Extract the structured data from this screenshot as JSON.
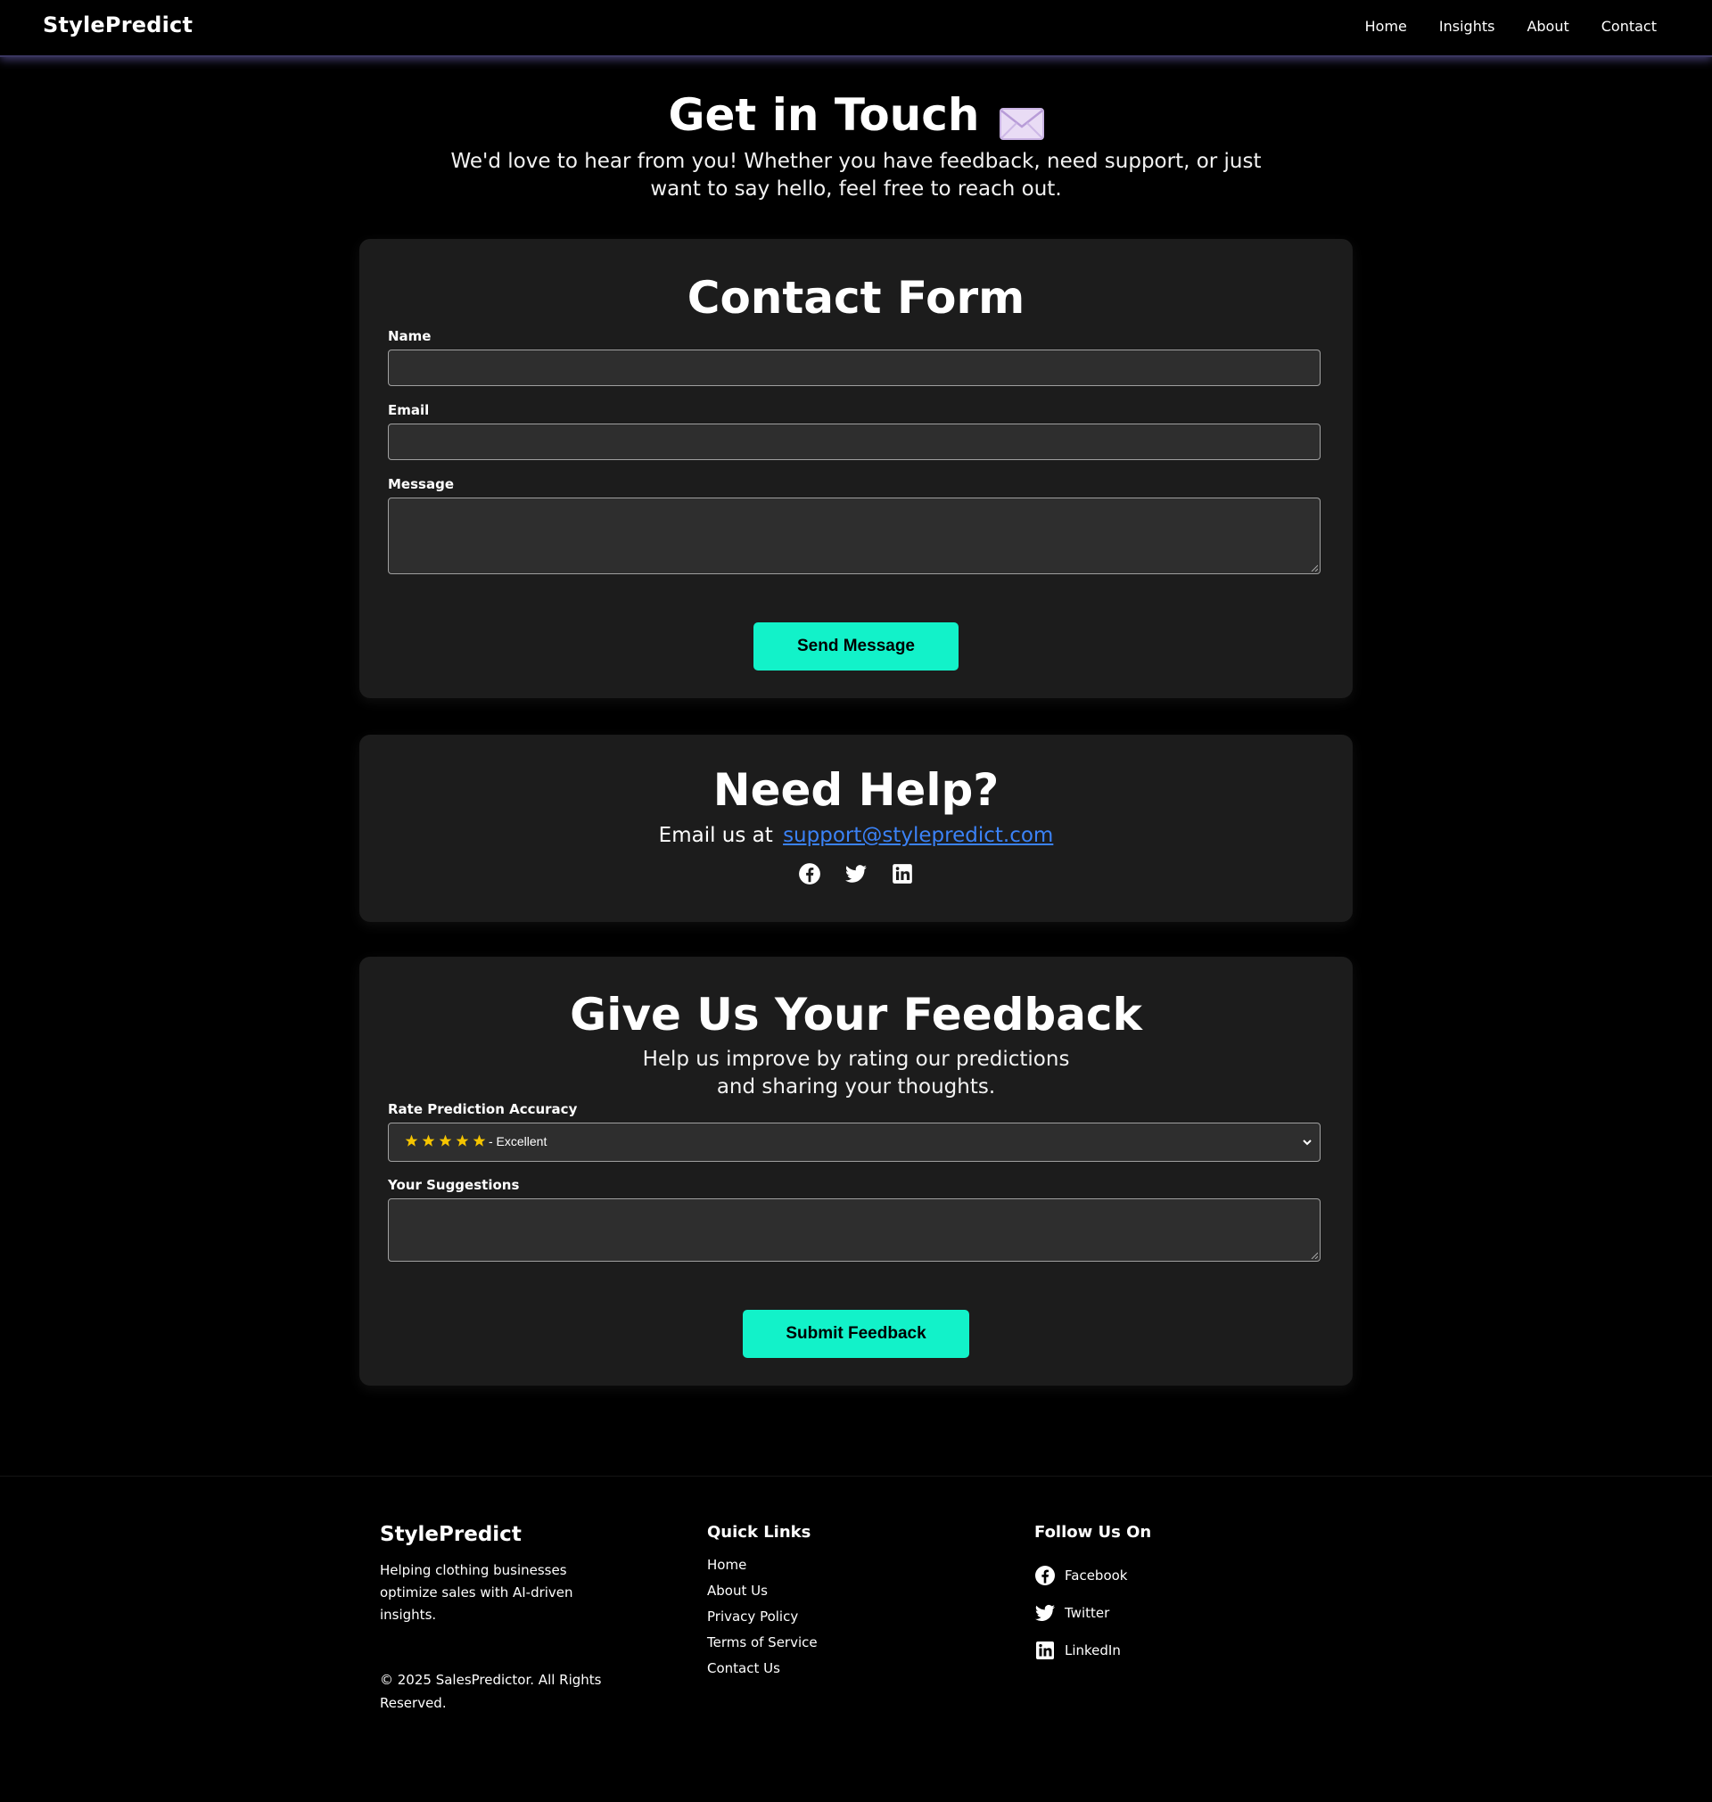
{
  "nav": {
    "brand": "StylePredict",
    "links": [
      "Home",
      "Insights",
      "About",
      "Contact"
    ]
  },
  "hero": {
    "title": "Get in Touch",
    "icon": "envelope-icon",
    "subtitle": "We'd love to hear from you! Whether you have feedback, need support, or just want to say hello, feel free to reach out."
  },
  "contact_form": {
    "title": "Contact Form",
    "name_label": "Name",
    "name_value": "",
    "email_label": "Email",
    "email_value": "",
    "message_label": "Message",
    "message_value": "",
    "submit_label": "Send Message"
  },
  "help": {
    "title": "Need Help?",
    "email_prefix": "Email us at",
    "email": "support@stylepredict.com",
    "social_icons": [
      "facebook-icon",
      "twitter-icon",
      "linkedin-icon"
    ]
  },
  "feedback": {
    "title": "Give Us Your Feedback",
    "subtitle": "Help us improve by rating our predictions and sharing your thoughts.",
    "rating_label": "Rate Prediction Accuracy",
    "rating_stars": 5,
    "rating_text": "- Excellent",
    "suggestions_label": "Your Suggestions",
    "suggestions_value": "",
    "submit_label": "Submit Feedback"
  },
  "footer": {
    "brand": "StylePredict",
    "description": "Helping clothing businesses optimize sales with AI-driven insights.",
    "copyright": "© 2025 SalesPredictor. All Rights Reserved.",
    "quick_links_title": "Quick Links",
    "quick_links": [
      "Home",
      "About Us",
      "Privacy Policy",
      "Terms of Service",
      "Contact Us"
    ],
    "follow_title": "Follow Us On",
    "social": [
      {
        "icon": "facebook-icon",
        "label": "Facebook"
      },
      {
        "icon": "twitter-icon",
        "label": "Twitter"
      },
      {
        "icon": "linkedin-icon",
        "label": "LinkedIn"
      }
    ]
  },
  "colors": {
    "background": "#000000",
    "card": "#1c1c1c",
    "accent": "#12f2c9",
    "link": "#3b82f6",
    "star": "#f5c400"
  }
}
